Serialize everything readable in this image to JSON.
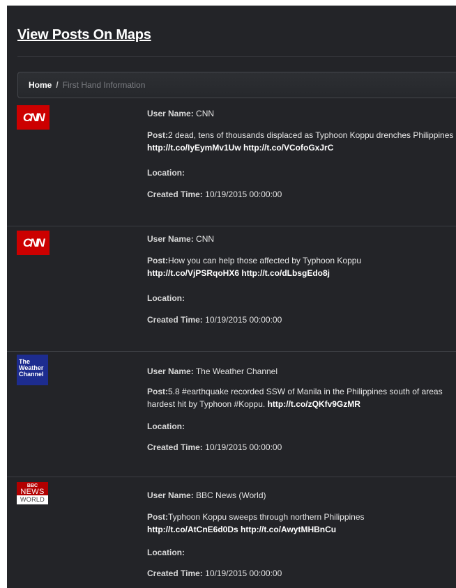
{
  "header": {
    "title": "View Posts On Maps"
  },
  "breadcrumb": {
    "home": "Home",
    "separator": "/",
    "current": "First Hand Information"
  },
  "labels": {
    "user_name": "User Name:",
    "post": "Post:",
    "location": "Location:",
    "created_time": "Created Time:"
  },
  "posts": [
    {
      "avatar_icon": "cnn-logo-icon",
      "avatar_text": "CNN",
      "user_name": "CNN",
      "text": "2 dead, tens of thousands displaced as Typhoon Koppu drenches Philippines",
      "links": [
        "http://t.co/IyEymMv1Uw",
        "http://t.co/VCofoGxJrC"
      ],
      "location": "",
      "created_time": "10/19/2015 00:00:00"
    },
    {
      "avatar_icon": "cnn-logo-icon",
      "avatar_text": "CNN",
      "user_name": "CNN",
      "text": "How you can help those affected by Typhoon Koppu",
      "links": [
        "http://t.co/VjPSRqoHX6",
        "http://t.co/dLbsgEdo8j"
      ],
      "location": "",
      "created_time": "10/19/2015 00:00:00"
    },
    {
      "avatar_icon": "weather-channel-logo-icon",
      "avatar_lines": [
        "The",
        "Weather",
        "Channel"
      ],
      "user_name": "The Weather Channel",
      "text": "5.8 #earthquake recorded SSW of Manila in the Philippines south of areas hardest hit by Typhoon #Koppu.",
      "links": [
        "http://t.co/zQKfv9GzMR"
      ],
      "location": "",
      "created_time": "10/19/2015 00:00:00"
    },
    {
      "avatar_icon": "bbc-news-world-logo-icon",
      "avatar_lines": [
        "BBC",
        "NEWS",
        "WORLD"
      ],
      "user_name": "BBC News (World)",
      "text": "Typhoon Koppu sweeps through northern Philippines",
      "links": [
        "http://t.co/AtCnE6d0Ds",
        "http://t.co/AwytMHBnCu"
      ],
      "location": "",
      "created_time": "10/19/2015 00:00:00"
    }
  ],
  "colors": {
    "background": "#232428",
    "cnn_red": "#cc0000",
    "weather_blue": "#1d2c8f",
    "bbc_red": "#b20000"
  }
}
